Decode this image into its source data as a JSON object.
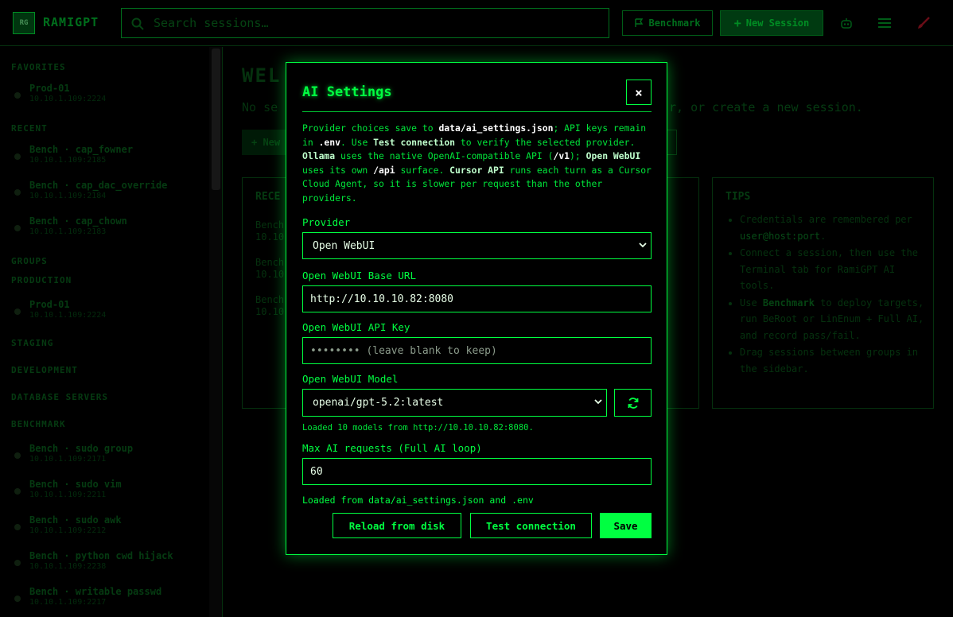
{
  "header": {
    "logo": "RG",
    "brand": "RAMIGPT",
    "search_placeholder": "Search sessions…",
    "benchmark_label": "Benchmark",
    "new_session_label": "New Session"
  },
  "sidebar": {
    "favorites_title": "FAVORITES",
    "favorites": [
      {
        "name": "Prod-01",
        "host": "10.10.1.109:2224"
      }
    ],
    "recent_title": "RECENT",
    "recent": [
      {
        "name": "Bench · cap_fowner",
        "host": "10.10.1.109:2185"
      },
      {
        "name": "Bench · cap_dac_override",
        "host": "10.10.1.109:2184"
      },
      {
        "name": "Bench · cap_chown",
        "host": "10.10.1.109:2183"
      }
    ],
    "groups_title": "GROUPS",
    "production_title": "PRODUCTION",
    "production": [
      {
        "name": "Prod-01",
        "host": "10.10.1.109:2224"
      }
    ],
    "staging_title": "STAGING",
    "development_title": "DEVELOPMENT",
    "database_title": "DATABASE SERVERS",
    "benchmark_title": "BENCHMARK",
    "benchmark": [
      {
        "name": "Bench · sudo group",
        "host": "10.10.1.109:2171"
      },
      {
        "name": "Bench · sudo vim",
        "host": "10.10.1.109:2211"
      },
      {
        "name": "Bench · sudo awk",
        "host": "10.10.1.109:2212"
      },
      {
        "name": "Bench · python cwd hijack",
        "host": "10.10.1.109:2238"
      },
      {
        "name": "Bench · writable passwd",
        "host": "10.10.1.109:2217"
      }
    ]
  },
  "main": {
    "welcome": "WEL",
    "subtitle_left": "No se",
    "subtitle_right": "r, or create a new session.",
    "new_button": "New",
    "recent_title": "RECE",
    "recent_rows": [
      {
        "name": "Bench",
        "host": "10.10"
      },
      {
        "name": "Bench",
        "host": "10.10"
      },
      {
        "name": "Bench",
        "host": "10.10"
      }
    ],
    "tips_title": "TIPS",
    "tips": [
      {
        "pre": "Credentials are remembered per ",
        "code": "user@host:port",
        "post": "."
      },
      {
        "pre": "Connect a session, then use the Terminal tab for RamiGPT AI tools.",
        "code": "",
        "post": ""
      },
      {
        "pre": "Use ",
        "bold": "Benchmark",
        "post": " to deploy targets, run BeRoot or LinEnum + Full AI, and record pass/fail."
      },
      {
        "pre": "Drag sessions between groups in the sidebar.",
        "code": "",
        "post": ""
      }
    ]
  },
  "modal": {
    "title": "AI Settings",
    "close": "×",
    "desc": {
      "t1": "Provider choices save to ",
      "c1": "data/ai_settings.json",
      "t2": "; API keys remain in ",
      "c2": ".env",
      "t3": ". Use ",
      "b1": "Test connection",
      "t4": " to verify the selected provider. ",
      "b2": "Ollama",
      "t5": " uses the native OpenAI-compatible API (",
      "c3": "/v1",
      "t6": "); ",
      "b3": "Open WebUI",
      "t7": " uses its own ",
      "c4": "/api",
      "t8": " surface. ",
      "b4": "Cursor API",
      "t9": " runs each turn as a Cursor Cloud Agent, so it is slower per request than the other providers."
    },
    "provider_label": "Provider",
    "provider_value": "Open WebUI",
    "base_url_label": "Open WebUI Base URL",
    "base_url_value": "http://10.10.10.82:8080",
    "api_key_label": "Open WebUI API Key",
    "api_key_placeholder": "•••••••• (leave blank to keep)",
    "model_label": "Open WebUI Model",
    "model_value": "openai/gpt-5.2:latest",
    "models_loaded": "Loaded 10 models from http://10.10.10.82:8080.",
    "max_label": "Max AI requests (Full AI loop)",
    "max_value": "60",
    "loaded_from": "Loaded from data/ai_settings.json and .env",
    "reload_label": "Reload from disk",
    "test_label": "Test connection",
    "save_label": "Save"
  },
  "colors": {
    "accent": "#00ff41",
    "background": "#000000",
    "dim": "#0a5a1a"
  }
}
